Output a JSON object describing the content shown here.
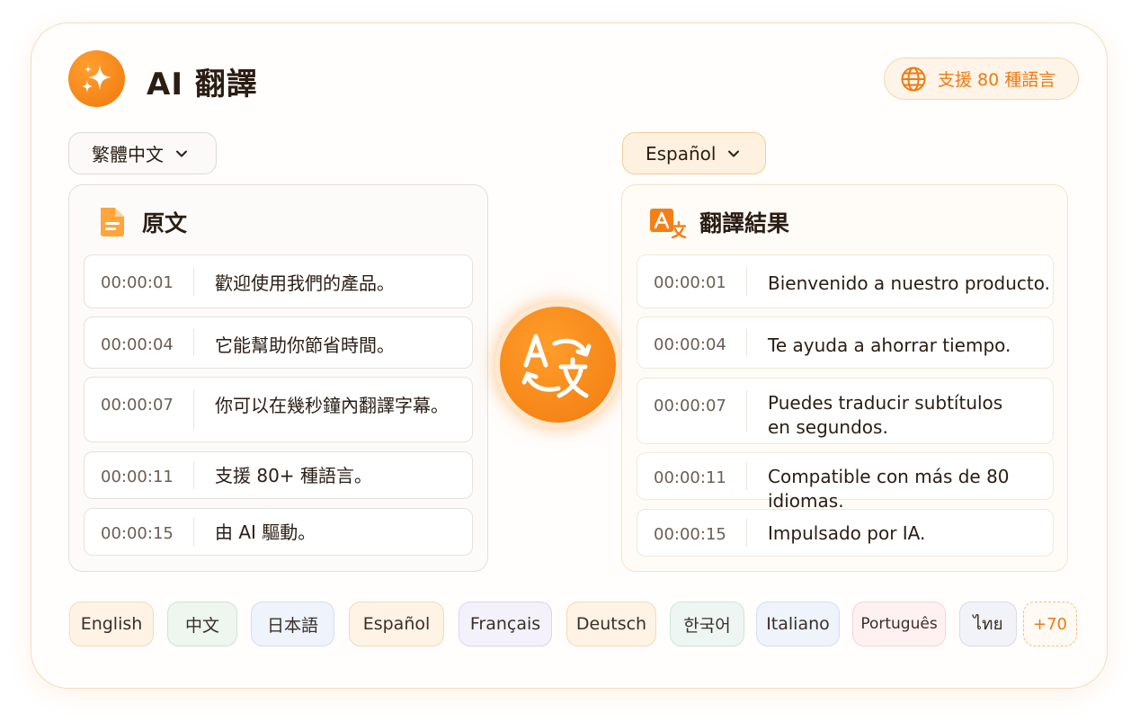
{
  "app": {
    "title": "AI 翻譯",
    "support_label": "支援 80 種語言"
  },
  "source": {
    "language": "繁體中文",
    "panel_title": "原文",
    "rows": [
      {
        "time": "00:00:01",
        "text": "歡迎使用我們的產品。"
      },
      {
        "time": "00:00:04",
        "text": "它能幫助你節省時間。"
      },
      {
        "time": "00:00:07",
        "text": "你可以在幾秒鐘內翻譯字幕。"
      },
      {
        "time": "00:00:11",
        "text": "支援 80+ 種語言。"
      },
      {
        "time": "00:00:15",
        "text": "由 AI 驅動。"
      }
    ]
  },
  "target": {
    "language": "Español",
    "panel_title": "翻譯結果",
    "rows": [
      {
        "time": "00:00:01",
        "text": "Bienvenido a nuestro producto."
      },
      {
        "time": "00:00:04",
        "text": "Te ayuda a ahorrar tiempo."
      },
      {
        "time": "00:00:07",
        "text": "Puedes traducir subtítulos",
        "text2": "en segundos."
      },
      {
        "time": "00:00:11",
        "text": "Compatible con más de 80 idiomas."
      },
      {
        "time": "00:00:15",
        "text": "Impulsado por IA."
      }
    ]
  },
  "language_chips": [
    "English",
    "中文",
    "日本語",
    "Español",
    "Français",
    "Deutsch",
    "한국어",
    "Italiano",
    "Português",
    "ไทย",
    "+70"
  ],
  "colors": {
    "accent": "#F27C10",
    "accent_light": "#FFF1DF"
  },
  "icons": {
    "logo": "sparkle-icon",
    "support": "globe-icon",
    "dropdown": "chevron-down-icon",
    "source_panel": "document-icon",
    "target_panel": "translate-icon",
    "swap": "translate-swap-icon"
  }
}
